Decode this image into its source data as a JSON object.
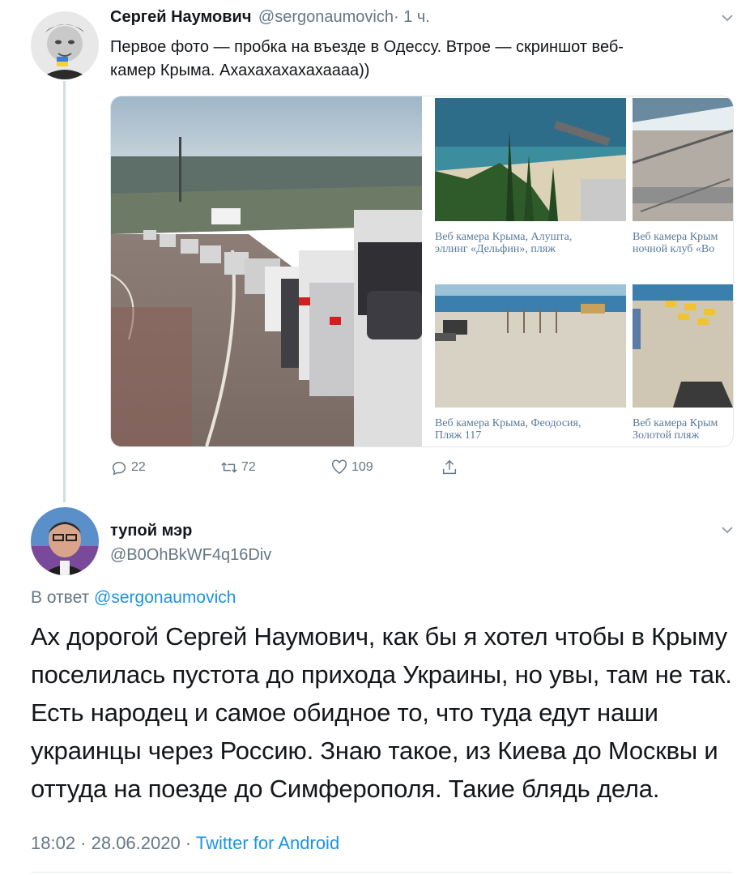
{
  "tweet1": {
    "author_name": "Сергей Наумович",
    "handle": "@sergonaumovich",
    "time": "· 1 ч.",
    "text_line1": "Первое фото — пробка на въезде в Одессу. Втрое — скриншот веб-",
    "text_line2": "камер Крыма. Ахахахахахахаааа))",
    "media": {
      "captions": [
        {
          "line1": "Веб камера Крыма, Алушта,",
          "line2": "эллинг «Дельфин», пляж"
        },
        {
          "line1": "Веб камера Крым",
          "line2": "ночной клуб «Во"
        },
        {
          "line1": "Веб камера Крыма, Феодосия,",
          "line2": "Пляж 117"
        },
        {
          "line1": "Веб камера Крым",
          "line2": "Золотой пляж"
        }
      ]
    },
    "actions": {
      "replies": "22",
      "retweets": "72",
      "likes": "109"
    }
  },
  "tweet2": {
    "author_name": "тупой мэр",
    "handle": "@B0OhBkWF4q16Div",
    "reply_to_label": "В ответ",
    "reply_to_handle": "@sergonaumovich",
    "text_lines": [
      "Ах дорогой Сергей Наумович, как бы я хотел чтобы в Крыму",
      "поселилась пустота до прихода Украины, но увы, там не так.",
      "Есть народец и самое обидное то, что туда едут наши",
      "украинцы через Россию. Знаю такое, из Киева до Москвы и",
      "оттуда на поезде до Симферополя. Такие блядь дела."
    ],
    "timestamp": "18:02 · 28.06.2020 ·",
    "source": "Twitter for Android"
  },
  "colors": {
    "accent": "#1b95e0",
    "secondary_text": "#657786",
    "primary_text": "#14171a"
  },
  "icons": [
    "reply-icon",
    "retweet-icon",
    "like-icon",
    "share-icon",
    "chevron-down-icon"
  ]
}
